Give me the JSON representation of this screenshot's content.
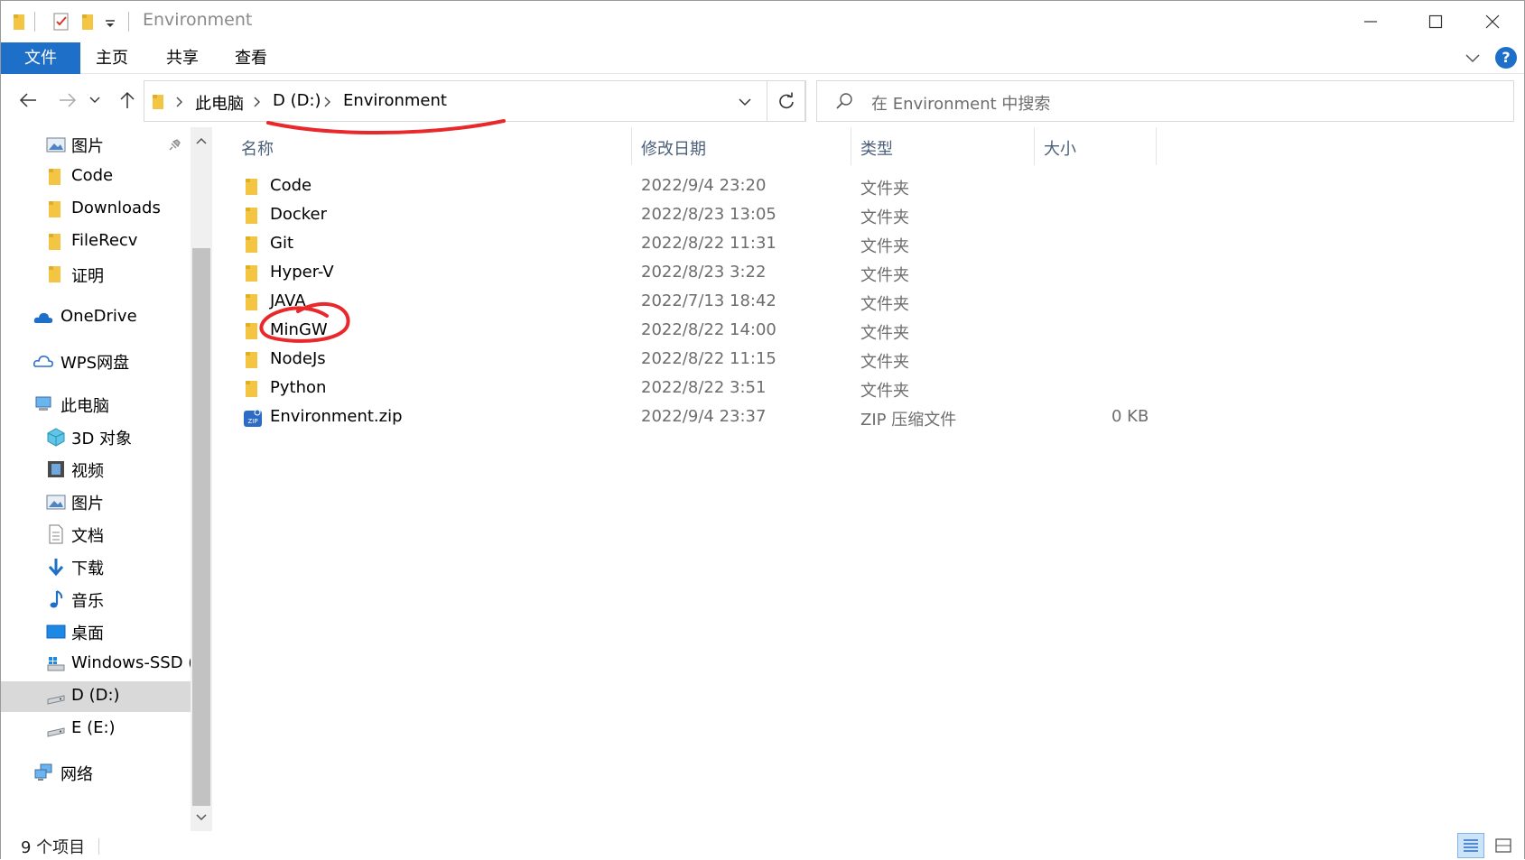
{
  "window": {
    "title": "Environment"
  },
  "ribbon": {
    "tabs": [
      "文件",
      "主页",
      "共享",
      "查看"
    ],
    "help_label": "?"
  },
  "address": {
    "crumbs": [
      "此电脑",
      "D (D:)",
      "Environment"
    ]
  },
  "search": {
    "placeholder": "在 Environment 中搜索"
  },
  "sidebar": {
    "quick_access": [
      {
        "label": "图片",
        "icon": "pictures-icon",
        "pinned": true
      },
      {
        "label": "Code",
        "icon": "folder-icon"
      },
      {
        "label": "Downloads",
        "icon": "folder-icon"
      },
      {
        "label": "FileRecv",
        "icon": "folder-icon"
      },
      {
        "label": "证明",
        "icon": "folder-icon"
      }
    ],
    "onedrive": "OneDrive",
    "wps": "WPS网盘",
    "this_pc": "此电脑",
    "pc_items": [
      {
        "label": "3D 对象",
        "icon": "3d-objects-icon"
      },
      {
        "label": "视频",
        "icon": "videos-icon"
      },
      {
        "label": "图片",
        "icon": "pictures-icon"
      },
      {
        "label": "文档",
        "icon": "documents-icon"
      },
      {
        "label": "下载",
        "icon": "download-icon"
      },
      {
        "label": "音乐",
        "icon": "music-icon"
      },
      {
        "label": "桌面",
        "icon": "desktop-icon"
      },
      {
        "label": "Windows-SSD (",
        "icon": "system-drive-icon"
      },
      {
        "label": "D (D:)",
        "icon": "drive-icon",
        "selected": true
      },
      {
        "label": "E (E:)",
        "icon": "drive-icon"
      }
    ],
    "network": "网络"
  },
  "columns": [
    "名称",
    "修改日期",
    "类型",
    "大小"
  ],
  "files": [
    {
      "name": "Code",
      "date": "2022/9/4 23:20",
      "type": "文件夹",
      "size": "",
      "kind": "folder"
    },
    {
      "name": "Docker",
      "date": "2022/8/23 13:05",
      "type": "文件夹",
      "size": "",
      "kind": "folder"
    },
    {
      "name": "Git",
      "date": "2022/8/22 11:31",
      "type": "文件夹",
      "size": "",
      "kind": "folder"
    },
    {
      "name": "Hyper-V",
      "date": "2022/8/23 3:22",
      "type": "文件夹",
      "size": "",
      "kind": "folder"
    },
    {
      "name": "JAVA",
      "date": "2022/7/13 18:42",
      "type": "文件夹",
      "size": "",
      "kind": "folder"
    },
    {
      "name": "MinGW",
      "date": "2022/8/22 14:00",
      "type": "文件夹",
      "size": "",
      "kind": "folder"
    },
    {
      "name": "NodeJs",
      "date": "2022/8/22 11:15",
      "type": "文件夹",
      "size": "",
      "kind": "folder"
    },
    {
      "name": "Python",
      "date": "2022/8/22 3:51",
      "type": "文件夹",
      "size": "",
      "kind": "folder"
    },
    {
      "name": "Environment.zip",
      "date": "2022/9/4 23:37",
      "type": "ZIP 压缩文件",
      "size": "0 KB",
      "kind": "zip"
    }
  ],
  "status": {
    "item_count": "9 个项目"
  },
  "colors": {
    "accent": "#1e6fc7",
    "folder": "#f4c542",
    "annotation": "#e8282b",
    "selection": "#d9d9d9"
  }
}
